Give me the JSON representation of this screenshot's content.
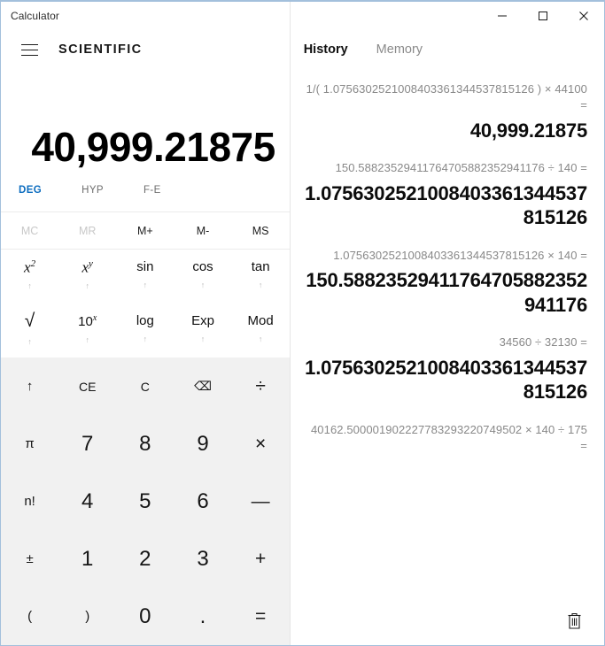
{
  "window": {
    "title": "Calculator",
    "controls": {
      "minimize": "minimize-icon",
      "maximize": "maximize-icon",
      "close": "close-icon"
    }
  },
  "left": {
    "menu_icon": "hamburger-menu-icon",
    "mode_title": "SCIENTIFIC",
    "display_value": "40,999.21875",
    "mode_toggles": [
      {
        "label": "DEG",
        "active": true
      },
      {
        "label": "HYP",
        "active": false
      },
      {
        "label": "F-E",
        "active": false
      }
    ],
    "memory_buttons": [
      {
        "label": "MC",
        "disabled": true
      },
      {
        "label": "MR",
        "disabled": true
      },
      {
        "label": "M+",
        "disabled": false
      },
      {
        "label": "M-",
        "disabled": false
      },
      {
        "label": "MS",
        "disabled": false
      }
    ],
    "function_buttons": [
      {
        "label": "x²",
        "name": "x-squared-button",
        "arrow": "↑"
      },
      {
        "label": "xʸ",
        "name": "x-power-y-button",
        "arrow": "↑"
      },
      {
        "label": "sin",
        "name": "sin-button",
        "arrow": "↑"
      },
      {
        "label": "cos",
        "name": "cos-button",
        "arrow": "↑"
      },
      {
        "label": "tan",
        "name": "tan-button",
        "arrow": "↑"
      },
      {
        "label": "√",
        "name": "square-root-button",
        "arrow": "↑"
      },
      {
        "label": "10ˣ",
        "name": "ten-power-x-button",
        "arrow": "↑"
      },
      {
        "label": "log",
        "name": "log-button",
        "arrow": "↑"
      },
      {
        "label": "Exp",
        "name": "exp-button",
        "arrow": "↑"
      },
      {
        "label": "Mod",
        "name": "mod-button",
        "arrow": "↑"
      }
    ],
    "keypad": [
      {
        "label": "↑",
        "name": "shift-up-button",
        "style": "fn"
      },
      {
        "label": "CE",
        "name": "clear-entry-button",
        "style": "small"
      },
      {
        "label": "C",
        "name": "clear-button",
        "style": "small"
      },
      {
        "label": "⌫",
        "name": "backspace-button",
        "style": "small"
      },
      {
        "label": "÷",
        "name": "divide-button",
        "style": "op"
      },
      {
        "label": "π",
        "name": "pi-button",
        "style": "fn"
      },
      {
        "label": "7",
        "name": "digit-7-button",
        "style": "num"
      },
      {
        "label": "8",
        "name": "digit-8-button",
        "style": "num"
      },
      {
        "label": "9",
        "name": "digit-9-button",
        "style": "num"
      },
      {
        "label": "×",
        "name": "multiply-button",
        "style": "op"
      },
      {
        "label": "n!",
        "name": "factorial-button",
        "style": "fn"
      },
      {
        "label": "4",
        "name": "digit-4-button",
        "style": "num"
      },
      {
        "label": "5",
        "name": "digit-5-button",
        "style": "num"
      },
      {
        "label": "6",
        "name": "digit-6-button",
        "style": "num"
      },
      {
        "label": "—",
        "name": "subtract-button",
        "style": "op"
      },
      {
        "label": "±",
        "name": "plus-minus-button",
        "style": "fn"
      },
      {
        "label": "1",
        "name": "digit-1-button",
        "style": "num"
      },
      {
        "label": "2",
        "name": "digit-2-button",
        "style": "num"
      },
      {
        "label": "3",
        "name": "digit-3-button",
        "style": "num"
      },
      {
        "label": "+",
        "name": "add-button",
        "style": "op"
      },
      {
        "label": "(",
        "name": "open-paren-button",
        "style": "fn"
      },
      {
        "label": ")",
        "name": "close-paren-button",
        "style": "fn"
      },
      {
        "label": "0",
        "name": "digit-0-button",
        "style": "num"
      },
      {
        "label": ".",
        "name": "decimal-point-button",
        "style": "num"
      },
      {
        "label": "=",
        "name": "equals-button",
        "style": "op"
      }
    ]
  },
  "right": {
    "tabs": [
      {
        "label": "History",
        "active": true
      },
      {
        "label": "Memory",
        "active": false
      }
    ],
    "history": [
      {
        "expression": "1/( 1.0756302521008403361344537815126 )  ×  44100 =",
        "result": "40,999.21875"
      },
      {
        "expression": "150.58823529411764705882352941176  ÷  140 =",
        "result": "1.0756302521008403361344537815126"
      },
      {
        "expression": "1.0756302521008403361344537815126  ×  140 =",
        "result": "150.58823529411764705882352941176"
      },
      {
        "expression": "34560  ÷  32130 =",
        "result": "1.0756302521008403361344537815126"
      },
      {
        "expression": "40162.500001902227783293220749502  ×  140  ÷  175 =",
        "result": ""
      }
    ],
    "clear_history_icon": "trash-icon"
  },
  "colors": {
    "accent": "#0b6cbf",
    "window_border": "#a3c0dc",
    "keypad_bg": "#f1f1f1",
    "muted_text": "#888888"
  }
}
